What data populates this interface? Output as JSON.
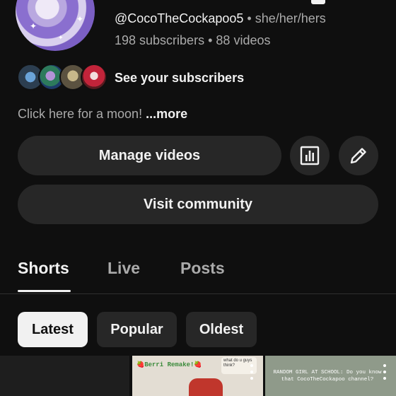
{
  "channel": {
    "handle": "@CocoTheCockapoo5",
    "separator": "•",
    "pronouns": "she/her/hers",
    "subscribers": "198 subscribers",
    "videos": "88 videos",
    "stats_separator": "•",
    "see_subscribers": "See your subscribers",
    "description": "Click here for a moon! ",
    "more_label": "...more"
  },
  "actions": {
    "manage_videos": "Manage videos",
    "analytics_icon": "bar-chart-icon",
    "edit_icon": "pencil-icon",
    "visit_community": "Visit community"
  },
  "tabs": [
    {
      "label": "Shorts",
      "selected": true
    },
    {
      "label": "Live",
      "selected": false
    },
    {
      "label": "Posts",
      "selected": false
    }
  ],
  "filters": [
    {
      "label": "Latest",
      "selected": true
    },
    {
      "label": "Popular",
      "selected": false
    },
    {
      "label": "Oldest",
      "selected": false
    }
  ],
  "shorts": [
    {
      "caption": ""
    },
    {
      "caption": "🍓Berri Remake!🍓",
      "bubble": "what do u guys think?"
    },
    {
      "caption": "RANDOM GIRL AT SCHOOL: Do you know that CocoTheCockapoo channel?"
    }
  ],
  "colors": {
    "background": "#0f0f0f",
    "button": "#272727",
    "text_primary": "#f1f1f1",
    "text_secondary": "#aaaaaa"
  }
}
